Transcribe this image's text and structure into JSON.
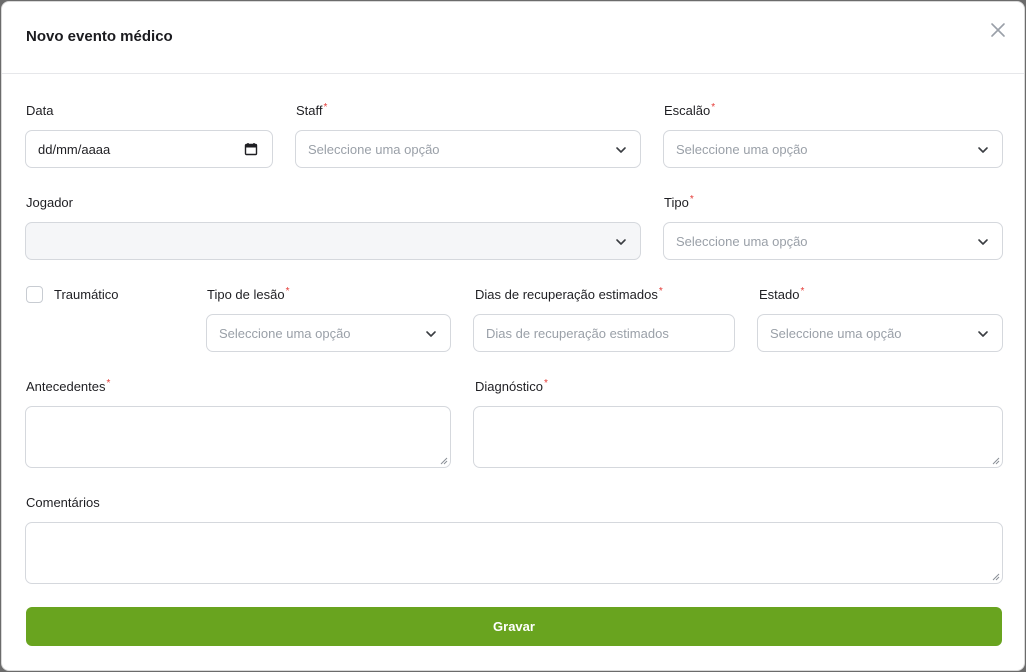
{
  "modal": {
    "title": "Novo evento médico",
    "close_icon": "close-icon"
  },
  "form": {
    "data": {
      "label": "Data",
      "value": "dd/mm/aaaa"
    },
    "staff": {
      "label": "Staff",
      "required": "*",
      "placeholder": "Seleccione uma opção"
    },
    "escalao": {
      "label": "Escalão",
      "required": "*",
      "placeholder": "Seleccione uma opção"
    },
    "jogador": {
      "label": "Jogador",
      "placeholder": ""
    },
    "tipo": {
      "label": "Tipo",
      "required": "*",
      "placeholder": "Seleccione uma opção"
    },
    "traumatico": {
      "label": "Traumático",
      "checked": false
    },
    "tipo_lesao": {
      "label": "Tipo de lesão",
      "required": "*",
      "placeholder": "Seleccione uma opção"
    },
    "dias": {
      "label": "Dias de recuperação estimados",
      "required": "*",
      "placeholder": "Dias de recuperação estimados"
    },
    "estado": {
      "label": "Estado",
      "required": "*",
      "placeholder": "Seleccione uma opção"
    },
    "antecedentes": {
      "label": "Antecedentes",
      "required": "*",
      "value": ""
    },
    "diagnostico": {
      "label": "Diagnóstico",
      "required": "*",
      "value": ""
    },
    "comentarios": {
      "label": "Comentários",
      "value": ""
    }
  },
  "actions": {
    "save_label": "Gravar"
  },
  "colors": {
    "primary": "#69a41f",
    "required": "#e53935",
    "border": "#d5d8dd"
  }
}
